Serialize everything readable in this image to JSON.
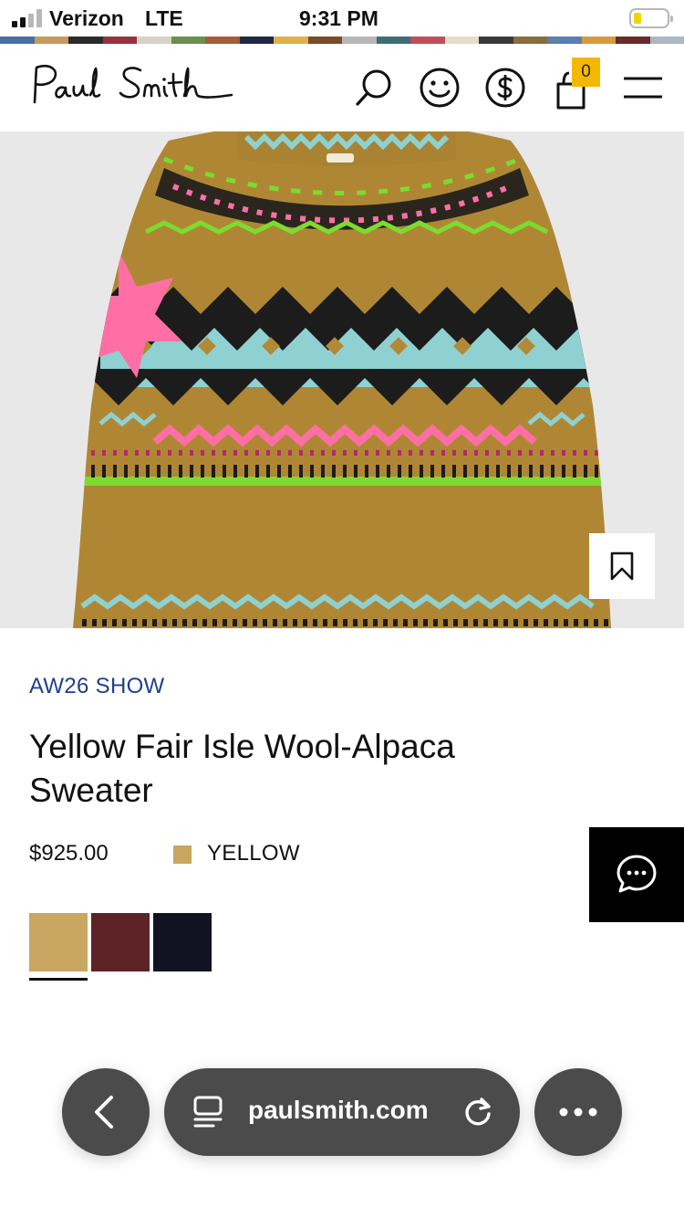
{
  "status_bar": {
    "carrier": "Verizon",
    "network": "LTE",
    "time": "9:31 PM",
    "battery_level_percent": 15,
    "battery_color": "#f4d400",
    "signal_bars_filled": 2,
    "signal_bars_total": 4
  },
  "brand_stripe_colors": [
    "#4a6fa5",
    "#c79a5b",
    "#2b2b2b",
    "#9c2f3e",
    "#d8d2c4",
    "#6b8f4e",
    "#a55c3a",
    "#1f2a44",
    "#e2b04a",
    "#7a4a2a",
    "#b7b7b7",
    "#3d6e75",
    "#c24d5a",
    "#e6ddc8",
    "#3a3a3a",
    "#8b6c3f",
    "#5a7fb0",
    "#d99a3b",
    "#6a2a2a",
    "#a9b8c4"
  ],
  "header": {
    "logo_text": "Paul Smith",
    "icons": [
      "search-icon",
      "account-icon",
      "currency-icon",
      "bag-icon",
      "menu-icon"
    ],
    "bag_count": "0",
    "bag_badge_color": "#f5b800"
  },
  "product": {
    "collection": "AW26 SHOW",
    "collection_color": "#1f3f8a",
    "name": "Yellow Fair Isle Wool-Alpaca Sweater",
    "price": "$925.00",
    "selected_colour_name": "YELLOW",
    "swatches": [
      {
        "name": "yellow",
        "color": "#c9a661",
        "selected": true
      },
      {
        "name": "burgundy",
        "color": "#5d2327",
        "selected": false
      },
      {
        "name": "navy",
        "color": "#121222",
        "selected": false
      }
    ]
  },
  "browser": {
    "url": "paulsmith.com",
    "icons": [
      "back-icon",
      "tabs-icon",
      "reload-icon",
      "more-icon"
    ]
  }
}
